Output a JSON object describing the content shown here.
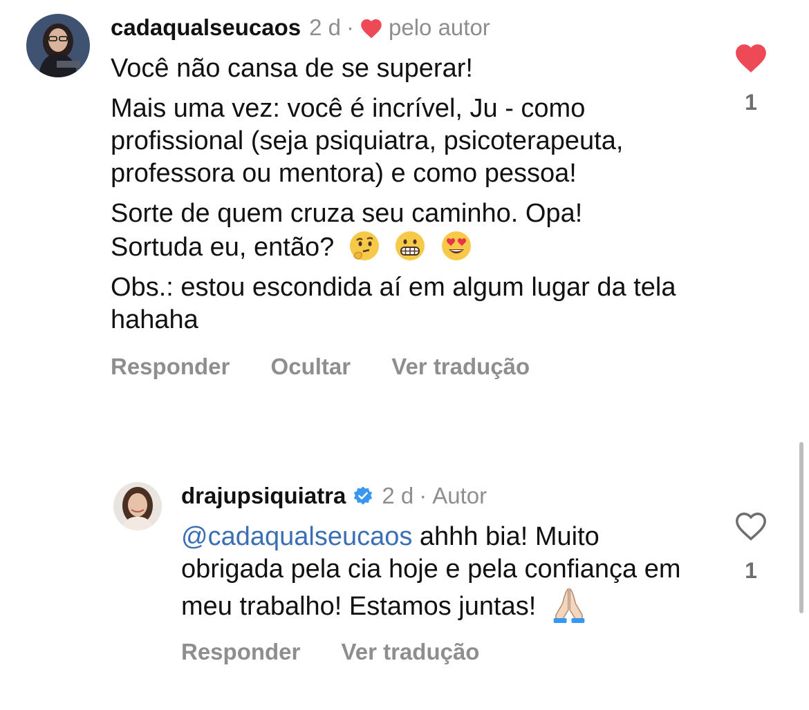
{
  "comments": [
    {
      "username": "cadaqualseucaos",
      "time": "2 d",
      "separator": "·",
      "liked_by_author_label": "pelo autor",
      "paragraphs": [
        "Você não cansa de se superar!",
        "Mais uma vez: você é incrível, Ju - como profissional (seja psiquiatra, psicoterapeuta, professora ou mentora) e como pessoa!",
        "Sorte de quem cruza seu caminho. Opa! Sortuda eu, então?",
        "Obs.: estou escondida aí em algum lugar da tela hahaha"
      ],
      "emojis": [
        "thinking-face",
        "grimacing-face",
        "heart-eyes-face"
      ],
      "actions": [
        "Responder",
        "Ocultar",
        "Ver tradução"
      ],
      "like_count": "1",
      "liked": true
    },
    {
      "username": "drajupsiquiatra",
      "verified": true,
      "time": "2 d",
      "separator": "·",
      "role": "Autor",
      "mention": "@cadaqualseucaos",
      "text_after_mention": " ahhh bia! Muito obrigada pela cia hoje e pela confiança em meu trabalho! Estamos juntas!",
      "emojis": [
        "folded-hands"
      ],
      "actions": [
        "Responder",
        "Ver tradução"
      ],
      "like_count": "1",
      "liked": false
    }
  ],
  "colors": {
    "text": "#111111",
    "meta_gray": "#8e8e8e",
    "like_red": "#ed4956",
    "verified_blue": "#3897f0",
    "mention_blue": "#3a6fb5"
  }
}
